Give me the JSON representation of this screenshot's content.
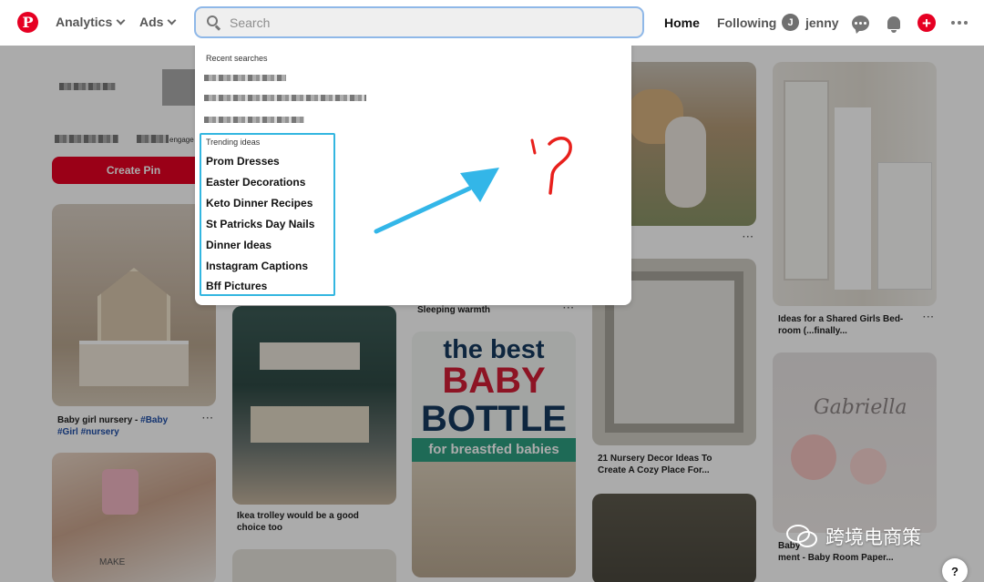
{
  "header": {
    "logo_letter": "P",
    "analytics_label": "Analytics",
    "ads_label": "Ads",
    "search_placeholder": "Search",
    "home_label": "Home",
    "following_label": "Following",
    "user_initial": "J",
    "user_name": "jenny",
    "create_symbol": "+"
  },
  "profile": {
    "engage_text": "engage",
    "create_pin_label": "Create Pin"
  },
  "dropdown": {
    "recent_label": "Recent searches",
    "trending_label": "Trending ideas",
    "trending": [
      "Prom Dresses",
      "Easter Decorations",
      "Keto Dinner Recipes",
      "St Patricks Day Nails",
      "Dinner Ideas",
      "Instagram Captions",
      "Bff Pictures"
    ]
  },
  "pins": {
    "baby_nursery_caption": "Baby girl nursery - ",
    "baby_nursery_tag1": "#Baby",
    "baby_nursery_tag2": "#Girl #nursery",
    "ikea_caption": "Ikea trolley would be a good choice too",
    "sleeping_caption": "Sleeping warmth",
    "decor_caption": "21 Nursery Decor Ideas To Create A Cozy Place For...",
    "shared_caption": "Ideas for a Shared Girls Bed-room (...finally...",
    "paper_caption_1": "Baby",
    "paper_caption_2": "ment - Baby Room Paper...",
    "bottle_line1": "the best",
    "bottle_line2": "BABY",
    "bottle_line3": "BOTTLE",
    "bottle_line4": "for breastfed babies",
    "gabriella": "Gabriella",
    "mug_text": "MAKE"
  },
  "annotation": {
    "question_mark": "?"
  },
  "watermark": {
    "text": "跨境电商策"
  },
  "help_label": "?",
  "colors": {
    "brand": "#e60023",
    "highlight": "#33b6e0",
    "annotation": "#e8201c"
  }
}
